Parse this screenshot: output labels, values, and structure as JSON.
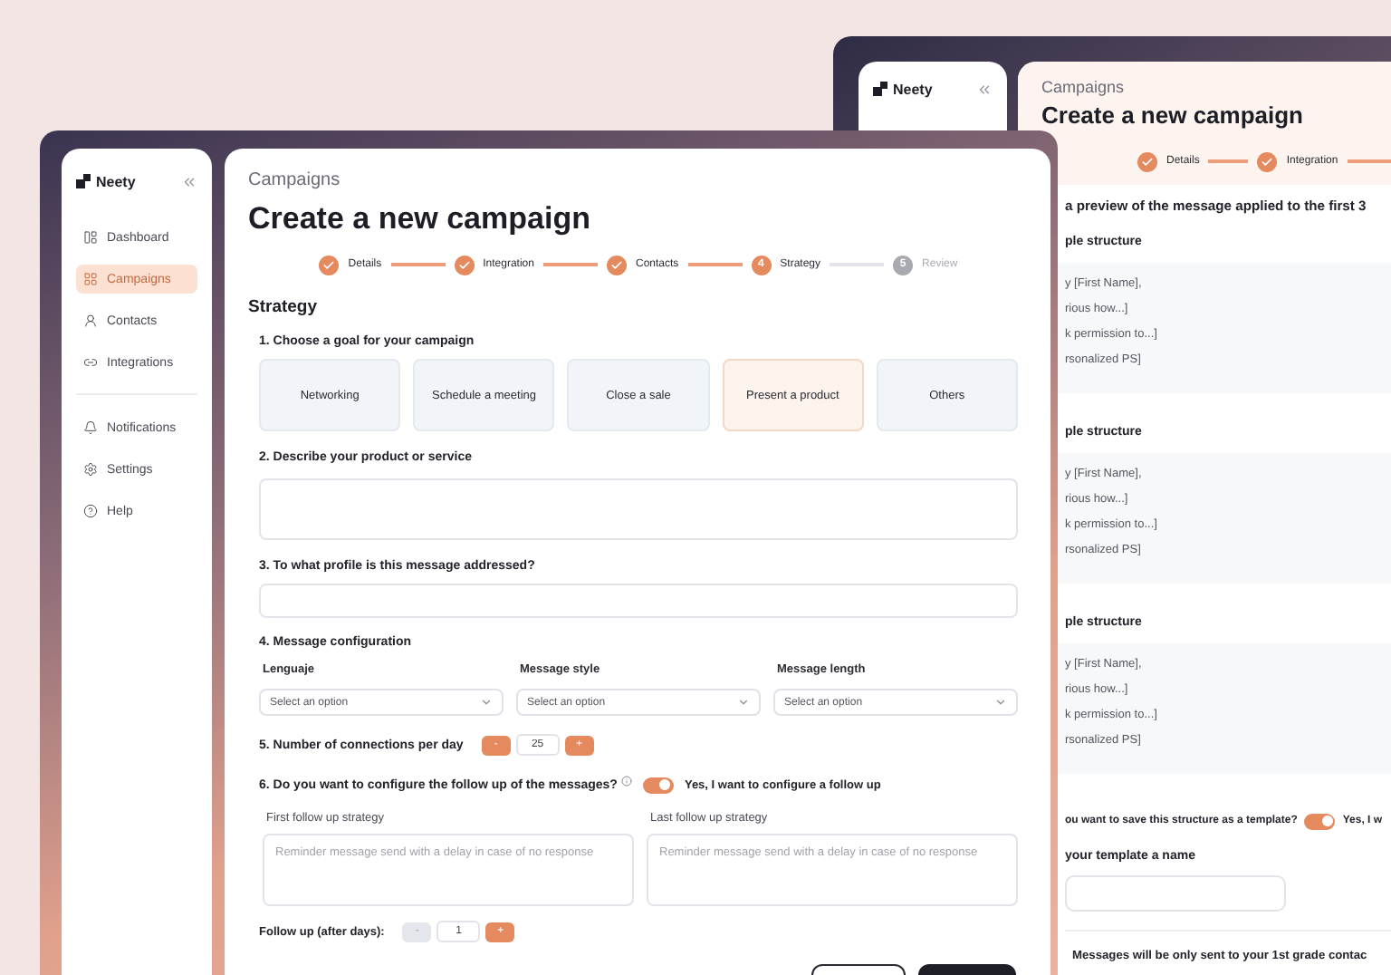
{
  "back_window": {
    "sidebar": {
      "logo": "Neety"
    },
    "breadcrumb": "Campaigns",
    "title": "Create a new campaign",
    "steps": [
      {
        "label": "Details",
        "done": true,
        "reached": true
      },
      {
        "label": "Integration",
        "done": true,
        "reached": true
      }
    ],
    "intro": "a preview of the message applied to the first 3",
    "previews": [
      {
        "heading": "ple structure",
        "lines": [
          "y [First Name],",
          "rious how...]",
          "k permission to...]",
          "rsonalized PS]"
        ]
      },
      {
        "heading": "ple structure",
        "lines": [
          "y [First Name],",
          "rious how...]",
          "k permission to...]",
          "rsonalized PS]"
        ]
      },
      {
        "heading": "ple structure",
        "lines": [
          "y [First Name],",
          "rious how...]",
          "k permission to...]",
          "rsonalized PS]"
        ]
      }
    ],
    "template_question": "ou want to save this structure as a template?",
    "template_toggle": {
      "on": true,
      "label": "Yes, I w"
    },
    "template_name_label": "your template a name",
    "notice": "Messages will be only sent to your 1st grade contac"
  },
  "front_window": {
    "sidebar": {
      "logo": "Neety",
      "nav_items": [
        {
          "label": "Dashboard",
          "selected": false
        },
        {
          "label": "Campaigns",
          "selected": true
        },
        {
          "label": "Contacts",
          "selected": false
        },
        {
          "label": "Integrations",
          "selected": false
        }
      ],
      "secondary_items": [
        {
          "label": "Notifications",
          "selected": false
        },
        {
          "label": "Settings",
          "selected": false
        },
        {
          "label": "Help",
          "selected": false
        }
      ]
    },
    "breadcrumb": "Campaigns",
    "title": "Create a new campaign",
    "steps": [
      {
        "label": "Details",
        "done": true,
        "reached": true
      },
      {
        "label": "Integration",
        "done": true,
        "reached": true
      },
      {
        "label": "Contacts",
        "done": true,
        "reached": true
      },
      {
        "label": "Strategy",
        "number": "4",
        "done": false,
        "reached": true
      },
      {
        "label": "Review",
        "number": "5",
        "done": false,
        "reached": false
      }
    ],
    "section_title": "Strategy",
    "goal_question": "1. Choose a goal for your campaign",
    "goals": [
      {
        "label": "Networking",
        "selected": false
      },
      {
        "label": "Schedule a meeting",
        "selected": false
      },
      {
        "label": "Close a sale",
        "selected": false
      },
      {
        "label": "Present a product",
        "selected": true
      },
      {
        "label": "Others",
        "selected": false
      }
    ],
    "describe_question": "2. Describe your product or service",
    "profile_question": "3. To what profile is this message addressed?",
    "config_question": "4. Message configuration",
    "config_selects": [
      {
        "label": "Lenguaje",
        "placeholder": "Select an option"
      },
      {
        "label": "Message style",
        "placeholder": "Select an option"
      },
      {
        "label": "Message length",
        "placeholder": "Select an option"
      }
    ],
    "connections": {
      "label": "5. Number of connections per day",
      "minus": "-",
      "value": "25",
      "plus": "+",
      "minus_disabled": false
    },
    "followup_question": "6. Do you want to configure the follow up of the messages?",
    "followup_toggle": {
      "on": true,
      "label": "Yes, I want to configure a follow up"
    },
    "followup_fields": [
      {
        "label": "First follow up strategy",
        "placeholder": "Reminder message send with a delay in case of no response"
      },
      {
        "label": "Last follow up strategy",
        "placeholder": "Reminder message send with a delay in case of no response"
      }
    ],
    "followup_days": {
      "label": "Follow up (after days):",
      "minus": "-",
      "value": "1",
      "plus": "+",
      "minus_disabled": true
    }
  }
}
